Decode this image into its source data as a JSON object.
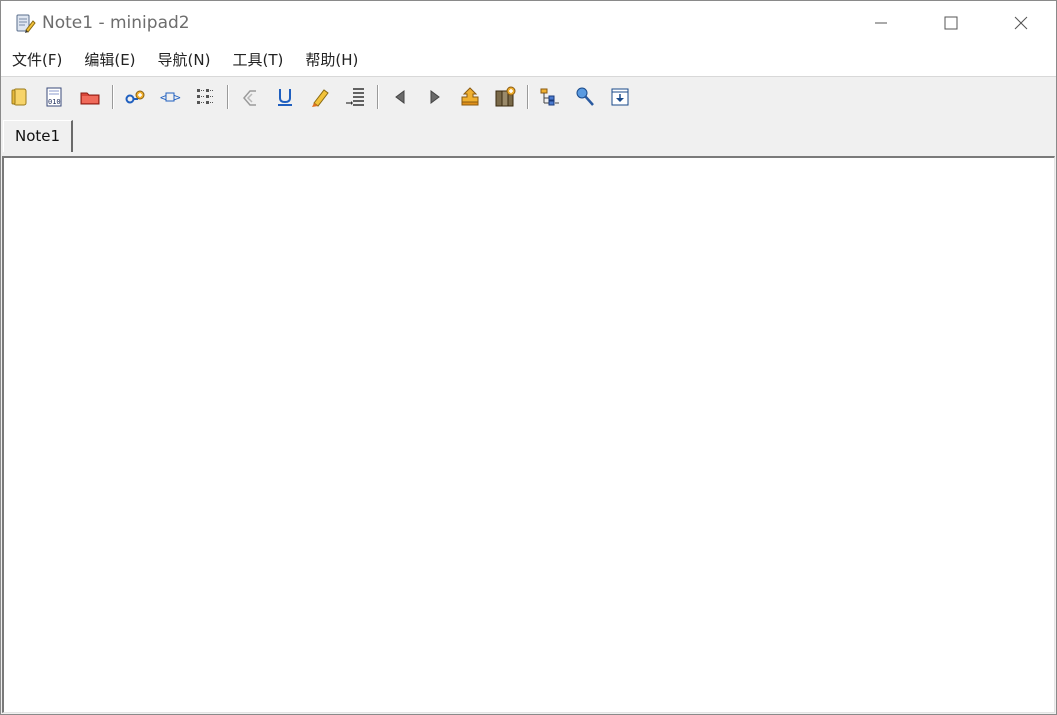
{
  "window": {
    "title": "Note1 - minipad2"
  },
  "menu": {
    "items": [
      {
        "label": "文件(F)"
      },
      {
        "label": "编辑(E)"
      },
      {
        "label": "导航(N)"
      },
      {
        "label": "工具(T)"
      },
      {
        "label": "帮助(H)"
      }
    ]
  },
  "toolbar": {
    "groups": [
      [
        "new-note-icon",
        "binary-file-icon",
        "open-folder-icon"
      ],
      [
        "add-link-icon",
        "tag-icon",
        "list-view-icon"
      ],
      [
        "undo-icon",
        "underline-icon",
        "highlighter-icon",
        "line-numbers-icon"
      ],
      [
        "prev-icon",
        "next-icon",
        "up-folder-icon",
        "clipboard-add-icon"
      ],
      [
        "tree-view-icon",
        "pin-icon",
        "download-icon"
      ]
    ]
  },
  "tabs": [
    {
      "label": "Note1",
      "active": true
    }
  ],
  "editor": {
    "content": ""
  },
  "colors": {
    "accent_blue": "#1f5fbf",
    "icon_orange": "#e8a020",
    "icon_red": "#c8342a"
  }
}
